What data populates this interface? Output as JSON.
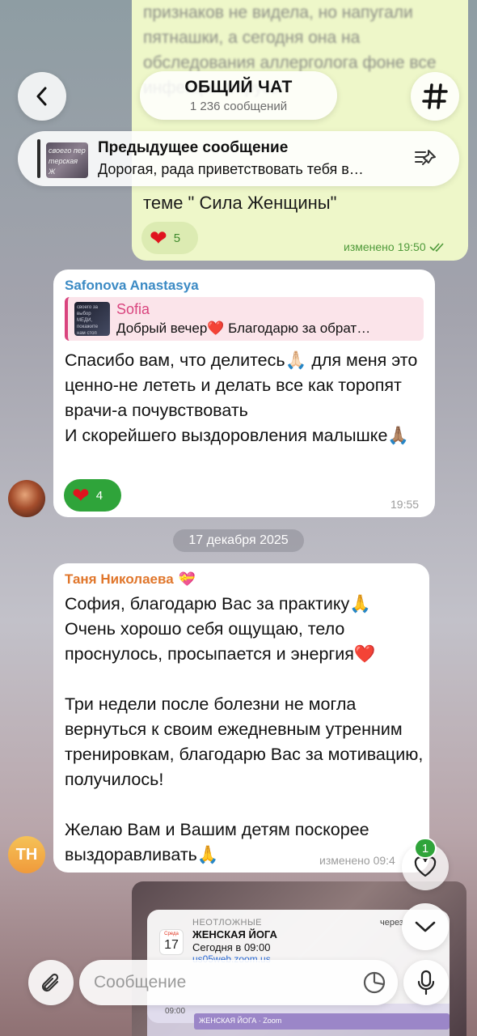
{
  "header": {
    "title": "ОБЩИЙ ЧАТ",
    "subtitle": "1 236 сообщений",
    "back_icon": "chevron-left-icon",
    "channel_icon": "hash-icon"
  },
  "previous_message_above": {
    "faded_text": "признаков не видела, но напугали пятнашки, а сегодня она на обследования аллерголога фоне все инфекции/вирусы",
    "visible_text": "теме \" Сила Женщины\"",
    "reaction": {
      "icon": "heart",
      "count": "5"
    },
    "meta": "изменено 19:50"
  },
  "pinned": {
    "thumb_text": "своего пер терская Ж",
    "title": "Предыдущее сообщение",
    "text": "Дорогая, рада приветствовать тебя в…",
    "icon": "unpin-icon"
  },
  "messages": [
    {
      "sender": "Safonova Anastasya",
      "reply": {
        "name": "Sofia",
        "text": "Добрый вечер❤️ Благодарю за обрат…",
        "thumb_text": "своего за выбор МЕДИ, покажите нам стоп Мастерская Женщины"
      },
      "text": "Спасибо вам, что делитесь🙏🏻 для меня это ценно-не лететь и делать все как торопят врачи-а почувствовать\nИ скорейшего выздоровления малышке🙏🏽",
      "reaction": {
        "icon": "heart",
        "count": "4"
      },
      "time": "19:55"
    },
    {
      "sender": "Таня Николаева",
      "sender_emoji": "💝",
      "text": "София, благодарю Вас за практику🙏\nОчень хорошо себя ощущаю, тело проснулось, просыпается и энергия❤️\n\nТри недели после болезни не могла вернуться к своим ежедневным утренним тренировкам, благодарю Вас за мотивацию, получилось!\n\nЖелаю Вам и Вашим детям поскорее выздоравливать🙏",
      "time": "изменено 09:4",
      "avatar_initials": "ТН"
    }
  ],
  "date_separator": "17 декабря 2025",
  "media_preview": {
    "urgent": "НЕОТЛОЖНЫЕ",
    "title": "ЖЕНСКАЯ ЙОГА",
    "time": "Сегодня в 09:00",
    "link": "us05web.zoom.us",
    "later": "через",
    "cal_day_name": "Среда",
    "cal_day": "17",
    "strip_time": "09:00",
    "strip_event": "ЖЕНСКАЯ ЙОГА · Zoom"
  },
  "floating": {
    "like_badge": "1"
  },
  "composer": {
    "placeholder": "Сообщение",
    "attach_icon": "paperclip-icon",
    "sticker_icon": "sticker-icon",
    "mic_icon": "microphone-icon"
  },
  "colors": {
    "outgoing_bubble": "#eef7c9",
    "incoming_bubble": "#ffffff",
    "sender1": "#3b8ac4",
    "sender2": "#e0762b",
    "reply_accent": "#d9447e",
    "reaction_green": "#2fa43a",
    "heart_red": "#e0141e"
  }
}
